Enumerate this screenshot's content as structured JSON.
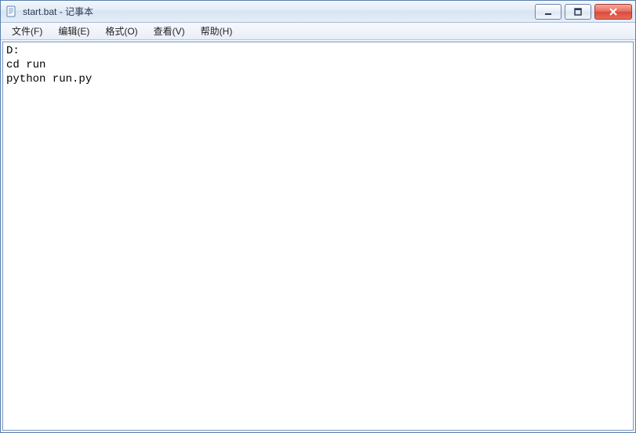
{
  "window": {
    "title": "start.bat - 记事本"
  },
  "menu": {
    "items": [
      {
        "label": "文件(F)"
      },
      {
        "label": "编辑(E)"
      },
      {
        "label": "格式(O)"
      },
      {
        "label": "查看(V)"
      },
      {
        "label": "帮助(H)"
      }
    ]
  },
  "editor": {
    "content": "D:\ncd run\npython run.py"
  }
}
